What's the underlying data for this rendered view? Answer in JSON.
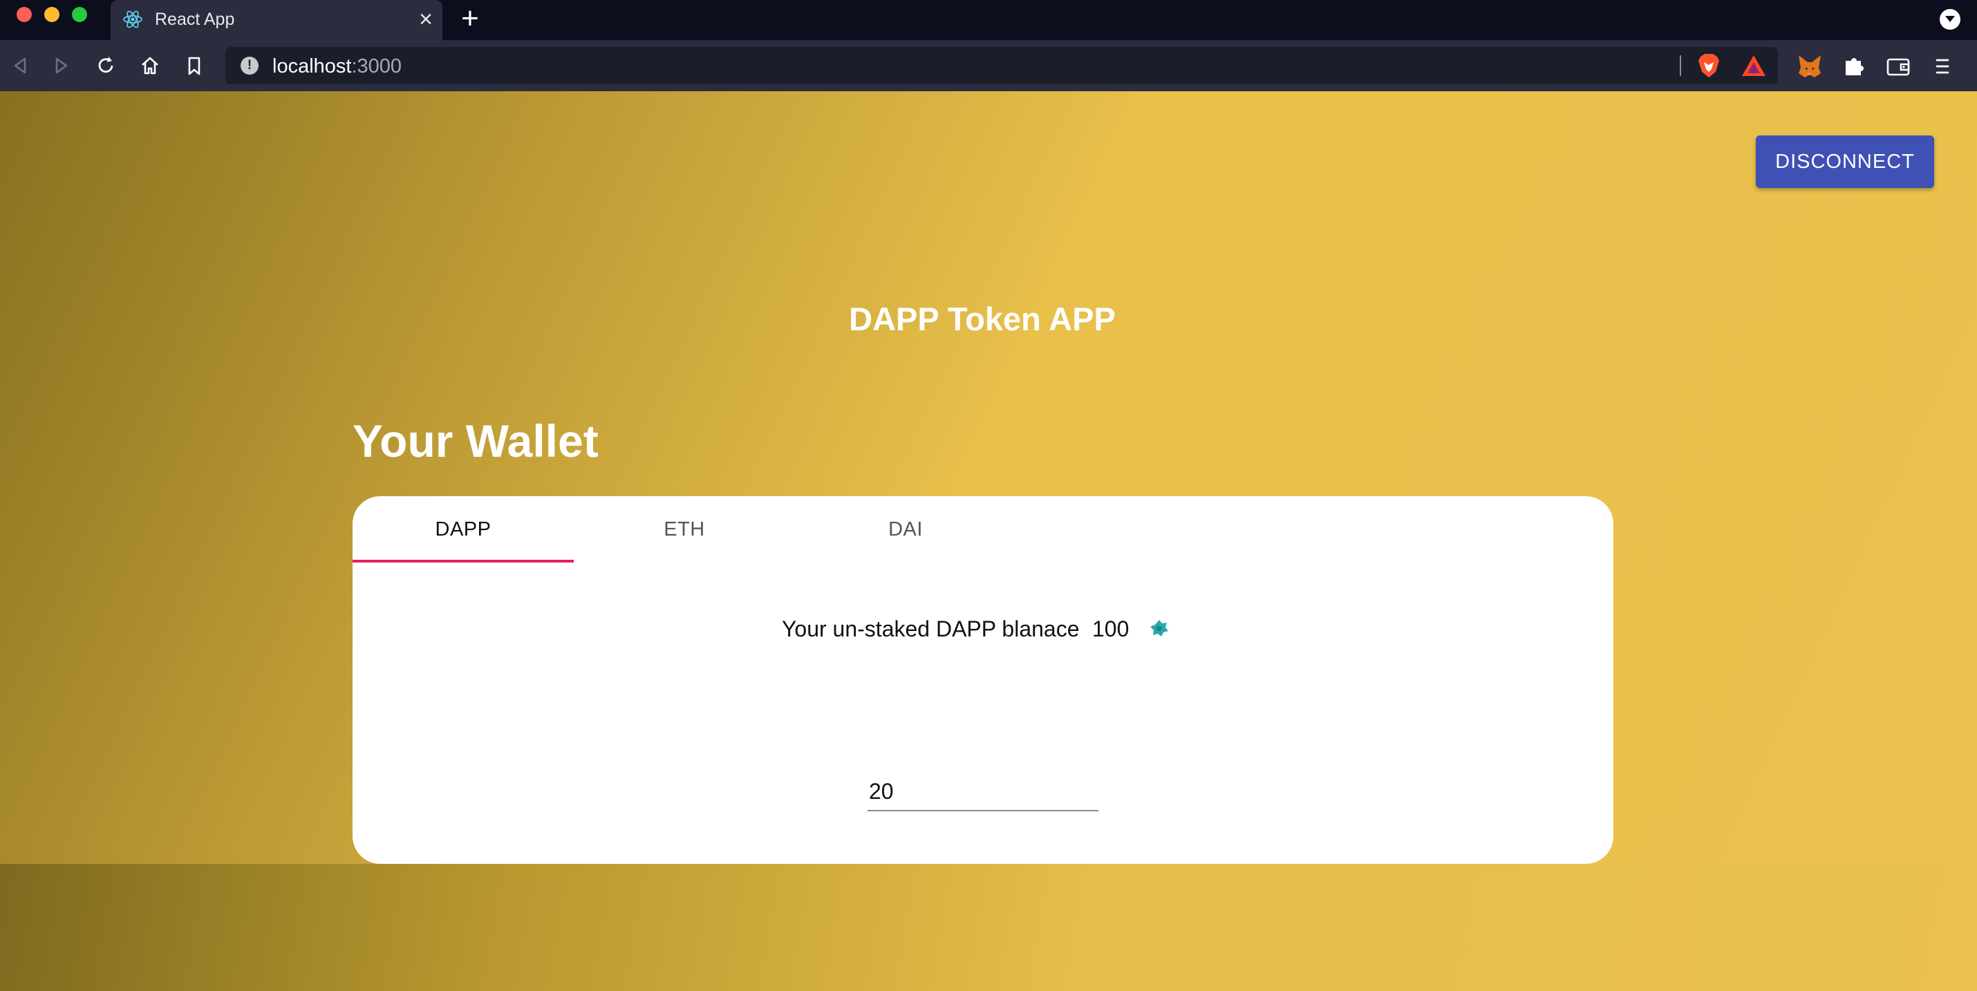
{
  "browser": {
    "tab_title": "React App",
    "url_host": "localhost",
    "url_port": ":3000"
  },
  "app": {
    "disconnect_label": "DISCONNECT",
    "title": "DAPP Token APP",
    "wallet_heading": "Your Wallet",
    "tabs": [
      {
        "label": "DAPP",
        "active": true
      },
      {
        "label": "ETH",
        "active": false
      },
      {
        "label": "DAI",
        "active": false
      }
    ],
    "balance_label": "Your un-staked DAPP blanace",
    "balance_value": "100",
    "amount_value": "20"
  },
  "colors": {
    "accent": "#3f51b5",
    "tab_indicator": "#e91e63",
    "token_icon": "#2aa8a8"
  },
  "icons": [
    "react-icon",
    "close-icon",
    "plus-icon",
    "back-icon",
    "forward-icon",
    "reload-icon",
    "home-icon",
    "bookmark-icon",
    "info-icon",
    "brave-icon",
    "bat-icon",
    "metamask-icon",
    "puzzle-icon",
    "wallet-icon",
    "menu-icon",
    "token-icon",
    "spinner-icon"
  ]
}
